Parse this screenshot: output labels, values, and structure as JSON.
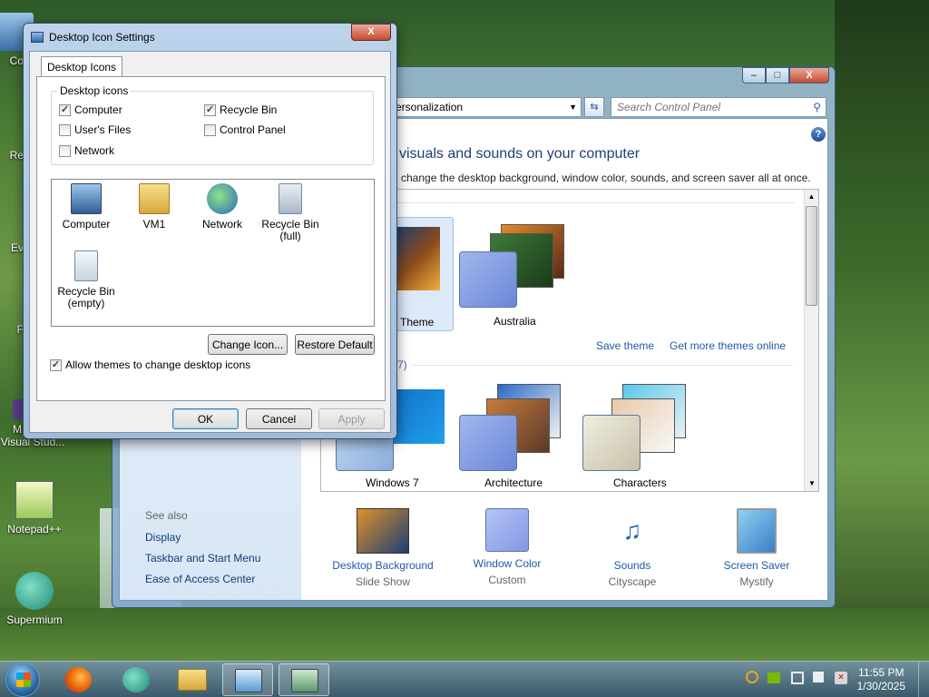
{
  "desktop_icons": [
    {
      "label": "Co"
    },
    {
      "label": "Re"
    },
    {
      "label": "Ev"
    },
    {
      "label": "F"
    },
    {
      "label": "M"
    },
    {
      "label": "Visual Stud..."
    },
    {
      "label": "Notepad++"
    },
    {
      "label": "Supermium"
    }
  ],
  "personalization": {
    "address": "ersonalization",
    "search_placeholder": "Search Control Panel",
    "heading": "visuals and sounds on your computer",
    "subheading": "change the desktop background, window color, sounds, and screen saver all at once.",
    "section1_count": ")",
    "section2_count": "(7)",
    "themes_row1": [
      "Theme",
      "Australia"
    ],
    "save_theme": "Save theme",
    "get_more": "Get more themes online",
    "themes_row2": [
      "Windows 7",
      "Architecture",
      "Characters"
    ],
    "see_also": {
      "title": "See also",
      "links": [
        "Display",
        "Taskbar and Start Menu",
        "Ease of Access Center"
      ]
    },
    "bottom": [
      {
        "title": "Desktop Background",
        "sub": "Slide Show"
      },
      {
        "title": "Window Color",
        "sub": "Custom"
      },
      {
        "title": "Sounds",
        "sub": "Cityscape"
      },
      {
        "title": "Screen Saver",
        "sub": "Mystify"
      }
    ],
    "help": "?"
  },
  "dialog": {
    "title": "Desktop Icon Settings",
    "tab": "Desktop Icons",
    "group_title": "Desktop icons",
    "checkboxes": [
      {
        "label": "Computer",
        "checked": true
      },
      {
        "label": "Recycle Bin",
        "checked": true
      },
      {
        "label": "User's Files",
        "checked": false
      },
      {
        "label": "Control Panel",
        "checked": false
      },
      {
        "label": "Network",
        "checked": false
      }
    ],
    "icons": [
      {
        "line1": "Computer",
        "line2": ""
      },
      {
        "line1": "VM1",
        "line2": ""
      },
      {
        "line1": "Network",
        "line2": ""
      },
      {
        "line1": "Recycle Bin",
        "line2": "(full)"
      },
      {
        "line1": "Recycle Bin",
        "line2": "(empty)"
      }
    ],
    "change_icon": "Change Icon...",
    "restore_default": "Restore Default",
    "allow_themes": "Allow themes to change desktop icons",
    "allow_themes_checked": true,
    "ok": "OK",
    "cancel": "Cancel",
    "apply": "Apply",
    "close": "X"
  },
  "taskbar": {
    "time": "11:55 PM",
    "date": "1/30/2025"
  },
  "window_controls": {
    "min": "–",
    "max": "□",
    "close": "X"
  }
}
